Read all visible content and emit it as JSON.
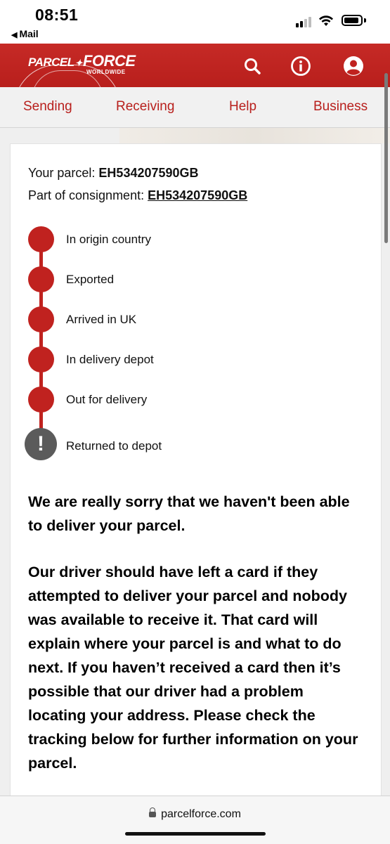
{
  "status_bar": {
    "time": "08:51",
    "back_label": "Mail"
  },
  "header": {
    "logo_text_left": "PARCEL",
    "logo_text_right": "FORCE",
    "logo_sub": "WORLDWIDE",
    "brand_color": "#c0221f",
    "icons": [
      "search-icon",
      "info-icon",
      "account-icon"
    ]
  },
  "nav": {
    "items": [
      "Sending",
      "Receiving",
      "Help",
      "Business"
    ]
  },
  "tracking": {
    "parcel_label": "Your parcel:",
    "parcel_number": "EH534207590GB",
    "consignment_label": "Part of consignment:",
    "consignment_number": "EH534207590GB",
    "steps": [
      {
        "label": "In origin country",
        "status": "complete"
      },
      {
        "label": "Exported",
        "status": "complete"
      },
      {
        "label": "Arrived in UK",
        "status": "complete"
      },
      {
        "label": "In delivery depot",
        "status": "complete"
      },
      {
        "label": "Out for delivery",
        "status": "complete"
      },
      {
        "label": "Returned to depot",
        "status": "exception"
      }
    ],
    "returned_icon": "!"
  },
  "message": {
    "apology": "We are really sorry that we haven't been able to deliver your parcel.",
    "body": "Our driver should have left a card if they attempted to deliver your parcel and nobody was available to receive it. That card will explain where your parcel is and what to do next.  If you haven’t received a card then it’s possible that our driver had a problem locating your address. Please check the tracking below for further information on your parcel."
  },
  "browser": {
    "url": "parcelforce.com"
  }
}
